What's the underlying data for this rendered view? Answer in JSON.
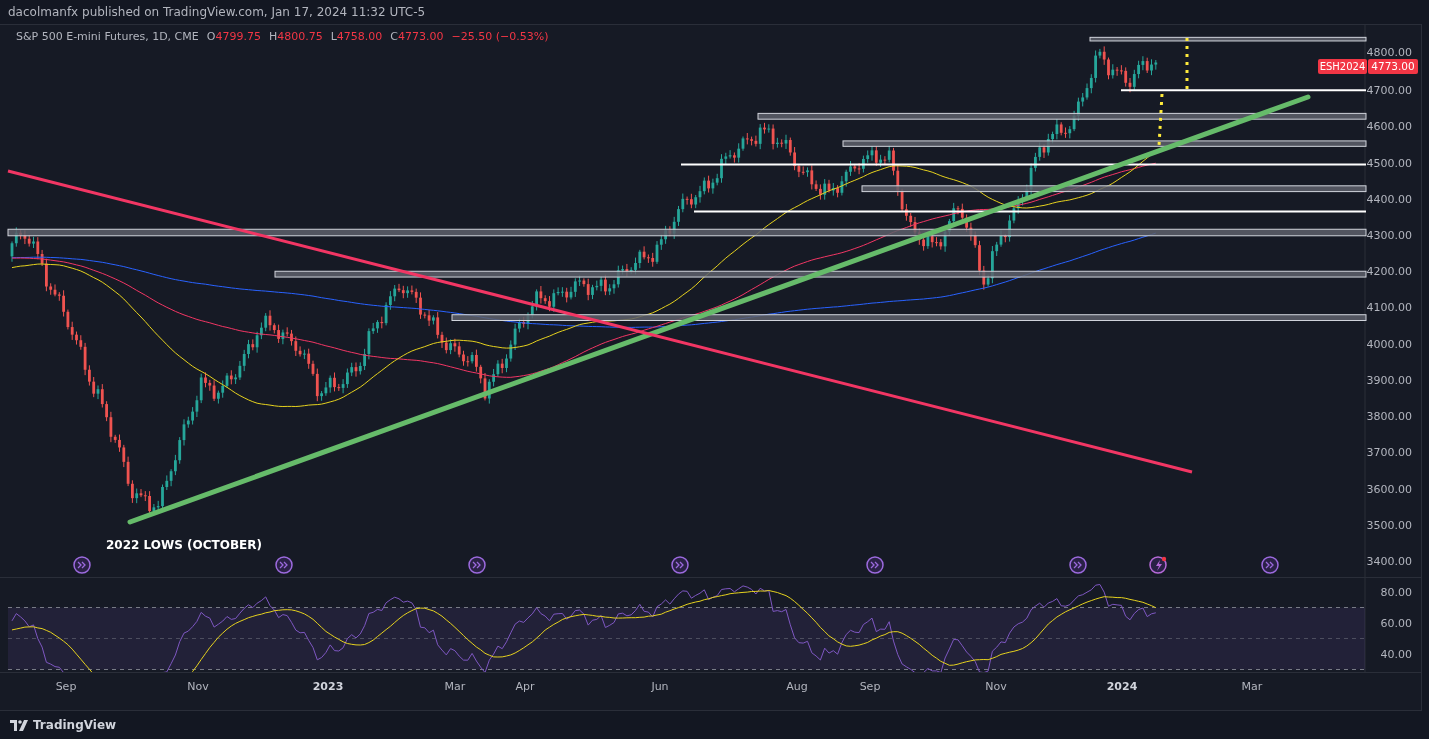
{
  "header": {
    "text": "dacolmanfx published on TradingView.com, Jan 17, 2024 11:32 UTC-5"
  },
  "legend": {
    "title": "S&P 500 E-mini Futures, 1D, CME",
    "values": [
      {
        "label": "O",
        "value": "4799.75"
      },
      {
        "label": "H",
        "value": "4800.75"
      },
      {
        "label": "L",
        "value": "4758.00"
      },
      {
        "label": "C",
        "value": "4773.00"
      }
    ],
    "change": "−25.50 (−0.53%)"
  },
  "price_tag": {
    "symbol": "ESH2024",
    "value": "4773.00"
  },
  "price_axis": {
    "labels": [
      "4800.00",
      "4700.00",
      "4600.00",
      "4500.00",
      "4400.00",
      "4300.00",
      "4200.00",
      "4100.00",
      "4000.00",
      "3900.00",
      "3800.00",
      "3700.00",
      "3600.00",
      "3500.00",
      "3400.00"
    ]
  },
  "annotation": {
    "text": "2022 LOWS (OCTOBER)"
  },
  "rsi_axis": {
    "labels": [
      "80.00",
      "60.00",
      "40.00"
    ]
  },
  "time_axis": {
    "labels": [
      {
        "text": "Sep",
        "kind": "month"
      },
      {
        "text": "Nov",
        "kind": "month"
      },
      {
        "text": "2023",
        "kind": "year"
      },
      {
        "text": "Mar",
        "kind": "month"
      },
      {
        "text": "Apr",
        "kind": "month"
      },
      {
        "text": "Jun",
        "kind": "month"
      },
      {
        "text": "Aug",
        "kind": "month"
      },
      {
        "text": "Sep",
        "kind": "month"
      },
      {
        "text": "Nov",
        "kind": "month"
      },
      {
        "text": "2024",
        "kind": "year"
      },
      {
        "text": "Mar",
        "kind": "month"
      }
    ]
  },
  "footer": {
    "brand": "TradingView"
  }
}
